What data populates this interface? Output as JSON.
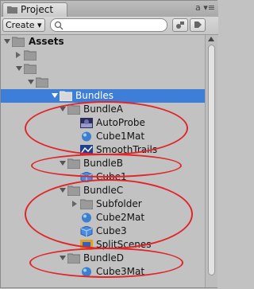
{
  "window": {
    "tab_label": "Project",
    "tab_right": "a ▾≡"
  },
  "toolbar": {
    "create_label": "Create ▾",
    "search_value": "",
    "search_placeholder": ""
  },
  "tree": {
    "assets_label": "Assets",
    "bundles_label": "Bundles",
    "bundleA": {
      "label": "BundleA",
      "items": [
        "AutoProbe",
        "Cube1Mat",
        "SmoothTrails"
      ]
    },
    "bundleB": {
      "label": "BundleB",
      "items": [
        "Cube1"
      ]
    },
    "bundleC": {
      "label": "BundleC",
      "items": [
        "Subfolder",
        "Cube2Mat",
        "Cube3",
        "SplitScenes"
      ]
    },
    "bundleD": {
      "label": "BundleD",
      "items": [
        "Cube3Mat"
      ]
    }
  },
  "colors": {
    "selection": "#3d7ed8",
    "annotation": "#e1262a",
    "panel": "#c2c2c2"
  }
}
